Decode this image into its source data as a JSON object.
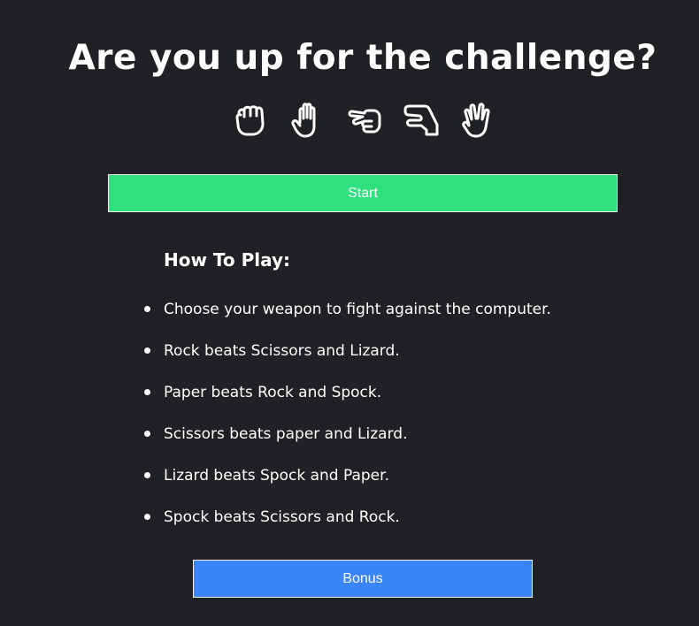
{
  "header": {
    "title": "Are you up for the challenge?"
  },
  "weapons": [
    {
      "name": "Rock",
      "icon": "hand-rock-icon"
    },
    {
      "name": "Paper",
      "icon": "hand-paper-icon"
    },
    {
      "name": "Scissors",
      "icon": "hand-scissors-icon"
    },
    {
      "name": "Lizard",
      "icon": "hand-lizard-icon"
    },
    {
      "name": "Spock",
      "icon": "hand-spock-icon"
    }
  ],
  "actions": {
    "start_label": "Start",
    "bonus_label": "Bonus"
  },
  "instructions": {
    "heading": "How To Play:",
    "rules": [
      "Choose your weapon to fight against the computer.",
      "Rock beats Scissors and Lizard.",
      "Paper beats Rock and Spock.",
      "Scissors beats paper and Lizard.",
      "Lizard beats Spock and Paper.",
      "Spock beats Scissors and Rock."
    ]
  },
  "colors": {
    "background": "#202124",
    "start_button": "#2ee07e",
    "bonus_button": "#3b86f7",
    "text": "#ffffff"
  }
}
